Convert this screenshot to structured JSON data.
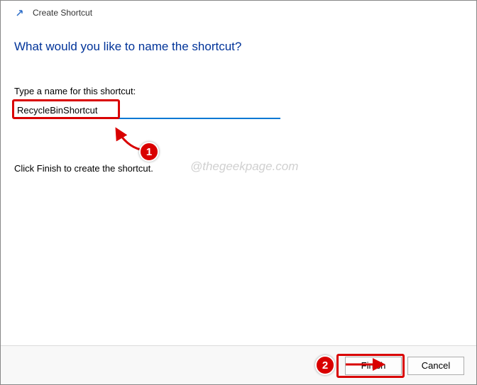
{
  "header": {
    "title": "Create Shortcut"
  },
  "content": {
    "heading": "What would you like to name the shortcut?",
    "label": "Type a name for this shortcut:",
    "input_value": "RecycleBinShortcut",
    "instruction": "Click Finish to create the shortcut."
  },
  "watermark": "@thegeekpage.com",
  "footer": {
    "finish_label": "Finish",
    "cancel_label": "Cancel"
  },
  "annotations": {
    "badge1": "1",
    "badge2": "2"
  }
}
